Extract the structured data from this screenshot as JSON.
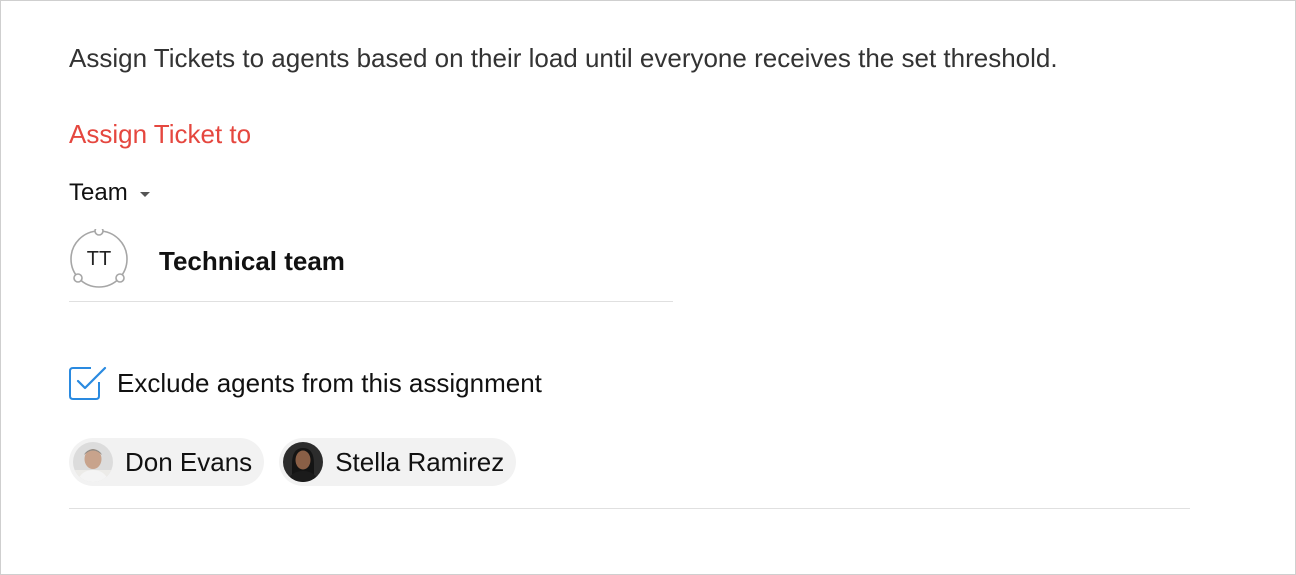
{
  "description": "Assign Tickets to agents based on their load until everyone receives the set threshold.",
  "assign_section": {
    "title": "Assign Ticket to",
    "title_color": "#e5473f",
    "type_selector": {
      "label": "Team",
      "icon": "caret-down-icon"
    },
    "selected_team": {
      "initials": "TT",
      "name": "Technical team",
      "icon": "team-avatar-icon"
    }
  },
  "exclude": {
    "checked": true,
    "label": "Exclude agents from this assignment",
    "checkbox_color": "#2a8ae0",
    "agents": [
      {
        "name": "Don Evans",
        "avatar": "agent-avatar-don"
      },
      {
        "name": "Stella Ramirez",
        "avatar": "agent-avatar-stella"
      }
    ]
  }
}
